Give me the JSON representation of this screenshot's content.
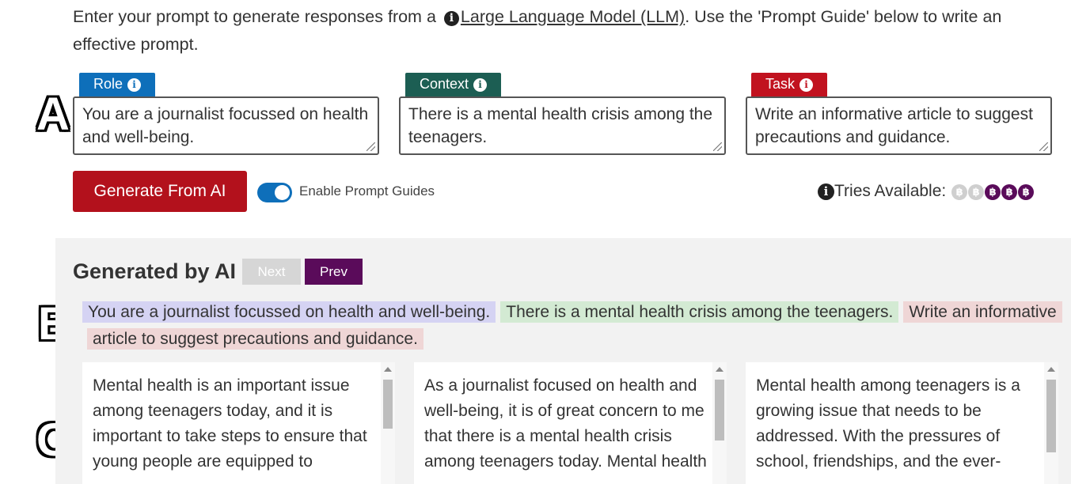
{
  "intro": {
    "before": "Enter your prompt to generate responses from a",
    "link": "Large Language Model (LLM)",
    "after": ". Use the 'Prompt Guide' below to write an effective prompt."
  },
  "markers": {
    "a": "A",
    "b": "B",
    "c": "C"
  },
  "prompt": {
    "role": {
      "tag": "Role",
      "value": "You are a journalist focussed on health and well-being."
    },
    "context": {
      "tag": "Context",
      "value": "There is a mental health crisis among the teenagers."
    },
    "task": {
      "tag": "Task",
      "value": "Write an informative article to suggest precautions and guidance."
    }
  },
  "controls": {
    "generate_label": "Generate From AI",
    "toggle_label": "Enable Prompt Guides",
    "toggle_on": true,
    "tries_label": "Tries Available:",
    "tries_used": 2,
    "tries_total": 5
  },
  "generated": {
    "title": "Generated by AI",
    "next_label": "Next",
    "prev_label": "Prev",
    "combined": {
      "role": "You are a journalist focussed on health and well-being.",
      "context": "There is a mental health crisis among the teenagers.",
      "task": "Write an informative article to suggest precautions and guidance."
    },
    "responses": [
      {
        "text": "Mental health is an important issue among teenagers today, and it is important to take steps to ensure that young people are equipped to",
        "scroll_fraction": 0.4
      },
      {
        "text": "As a journalist focused on health and well-being, it is of great concern to me that there is a mental health crisis among teenagers today. Mental health",
        "scroll_fraction": 0.5
      },
      {
        "text": "Mental health among teenagers is a growing issue that needs to be addressed. With the pressures of school, friendships, and the ever-",
        "scroll_fraction": 0.6
      }
    ]
  },
  "colors": {
    "role": "#0e6fba",
    "context": "#1c5e53",
    "task": "#c1121f",
    "generate": "#b3111c",
    "prev": "#5a0b5a",
    "coin_available": "#5a0b5a",
    "coin_used": "#cfcfcf"
  },
  "icons": {
    "info": "info-icon",
    "resize": "resize-grip-icon",
    "coin": "bitcoin-coin-icon"
  }
}
